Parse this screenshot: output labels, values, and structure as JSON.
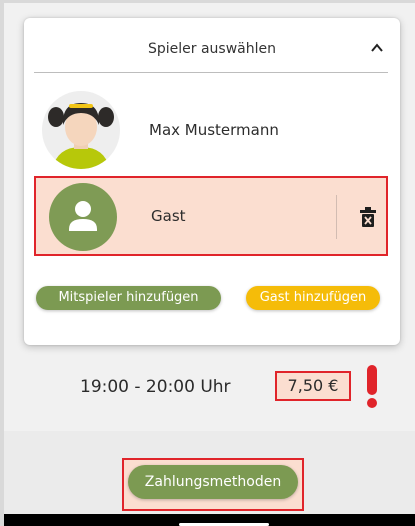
{
  "player_select": {
    "title": "Spieler auswählen",
    "players": [
      {
        "name": "Max Mustermann",
        "avatar_icon": "girl-avatar-icon"
      },
      {
        "name": "Gast",
        "avatar_icon": "person-avatar-icon",
        "delete_icon": "trash-icon"
      }
    ],
    "add_player_label": "Mitspieler hinzufügen",
    "add_guest_label": "Gast hinzufügen"
  },
  "booking": {
    "time": "19:00 - 20:00 Uhr",
    "price": "7,50 €"
  },
  "payment_button_label": "Zahlungsmethoden",
  "colors": {
    "green": "#7c9a52",
    "yellow": "#f5bc09",
    "highlight_red": "#e0242a",
    "highlight_fill": "#fbded0"
  }
}
